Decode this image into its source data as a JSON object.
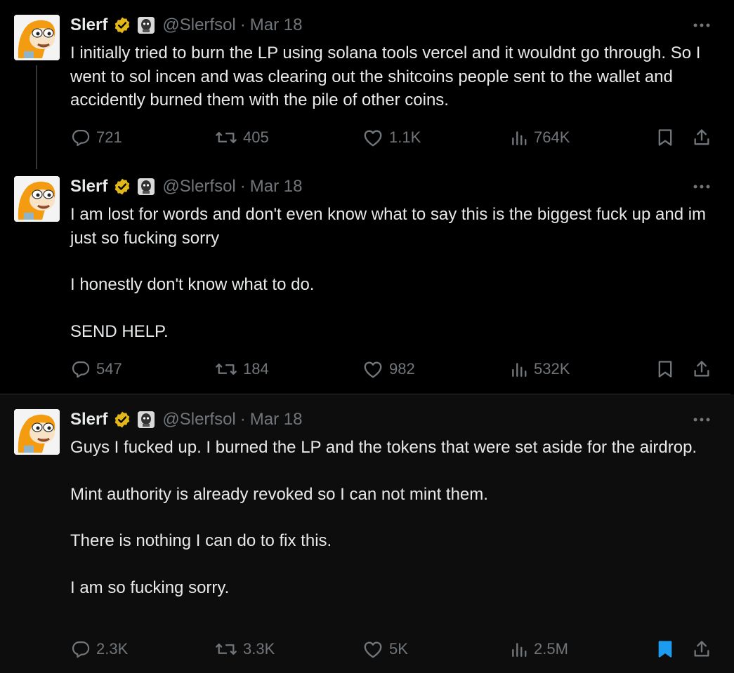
{
  "tweets": [
    {
      "name": "Slerf",
      "handle": "@Slerfsol",
      "separator": "·",
      "time": "Mar 18",
      "paragraphs": [
        "I initially tried to burn the LP using solana tools vercel and it wouldnt go through. So I went to sol incen and was clearing out the shitcoins people sent to the wallet and accidently burned them with the pile of other coins."
      ],
      "replies": "721",
      "reposts": "405",
      "likes": "1.1K",
      "views": "764K",
      "bookmarked": false
    },
    {
      "name": "Slerf",
      "handle": "@Slerfsol",
      "separator": "·",
      "time": "Mar 18",
      "paragraphs": [
        "I am lost for words and don't even know what to say this is the biggest fuck up and im just so fucking sorry",
        "I honestly don't know what to do.",
        "SEND HELP."
      ],
      "replies": "547",
      "reposts": "184",
      "likes": "982",
      "views": "532K",
      "bookmarked": false
    },
    {
      "name": "Slerf",
      "handle": "@Slerfsol",
      "separator": "·",
      "time": "Mar 18",
      "paragraphs": [
        "Guys I fucked up. I burned the LP and the tokens that were set aside for the airdrop.",
        "Mint authority is already revoked so I can not mint them.",
        "There is nothing I can do to fix this.",
        "I am so fucking sorry."
      ],
      "replies": "2.3K",
      "reposts": "3.3K",
      "likes": "5K",
      "views": "2.5M",
      "bookmarked": true
    }
  ],
  "icons": {
    "verified": "verified-badge-icon",
    "affiliate": "affiliate-badge-icon",
    "more": "more-options-icon",
    "reply": "reply-icon",
    "repost": "repost-icon",
    "like": "heart-icon",
    "views": "views-icon",
    "bookmark": "bookmark-icon",
    "share": "share-icon"
  },
  "colors": {
    "background": "#000000",
    "highlight_background": "#0d0d0d",
    "text": "#e7e9ea",
    "muted": "#71767b",
    "verified_gold": "#e2b719",
    "bookmark_active": "#1d9bf0"
  }
}
